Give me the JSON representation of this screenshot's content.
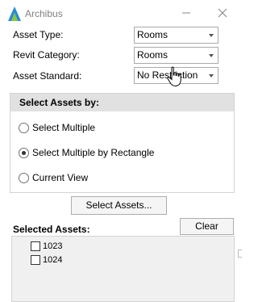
{
  "window": {
    "title": "Archibus",
    "icon": "archibus-logo-icon"
  },
  "fields": {
    "asset_type": {
      "label": "Asset Type:",
      "value": "Rooms"
    },
    "revit_category": {
      "label": "Revit Category:",
      "value": "Rooms"
    },
    "asset_standard": {
      "label": "Asset Standard:",
      "value": "No Restriction"
    }
  },
  "select_group": {
    "title": "Select Assets by:",
    "options": [
      {
        "label": "Select Multiple",
        "checked": false
      },
      {
        "label": "Select Multiple by Rectangle",
        "checked": true
      },
      {
        "label": "Current View",
        "checked": false
      }
    ]
  },
  "buttons": {
    "select_assets": "Select Assets...",
    "clear": "Clear"
  },
  "selected_assets": {
    "label": "Selected Assets:",
    "items": [
      "1023",
      "1024"
    ]
  },
  "colors": {
    "accent": "#2a8bd0",
    "group_header_bg": "#e1e1e1",
    "list_bg": "#f0f0f0"
  }
}
